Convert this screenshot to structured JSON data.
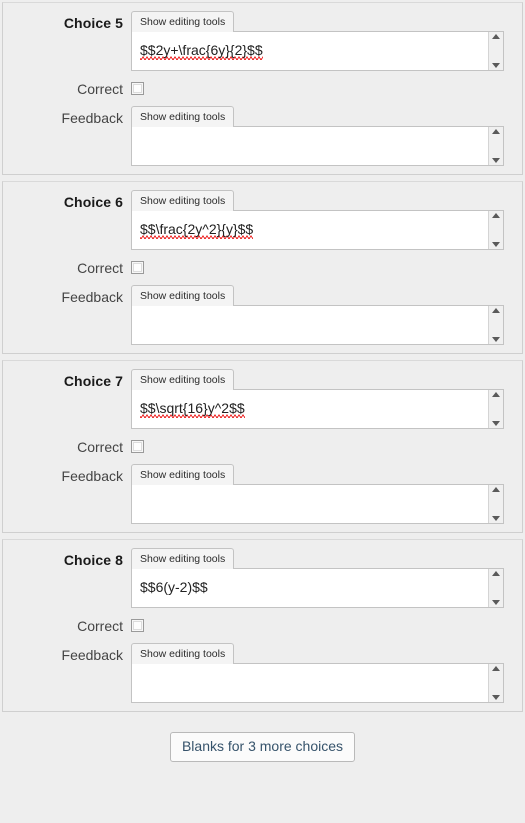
{
  "colors": {
    "page_background": "#eeeeee",
    "panel_border": "#cfcfcf",
    "field_border": "#c3c3c3",
    "text": "#333333",
    "button_text": "#36536b",
    "spellcheck_underline": "#ee3333"
  },
  "labels": {
    "correct": "Correct",
    "feedback": "Feedback",
    "editor_toggle": "Show editing tools"
  },
  "choices": [
    {
      "title": "Choice 5",
      "editor_toggle": "Show editing tools",
      "text_value": "$$2y+\\frac{6y}{2}$$",
      "text_placeholder": "",
      "correct_label": "Correct",
      "correct_checked": false,
      "feedback_label": "Feedback",
      "feedback_editor_toggle": "Show editing tools",
      "feedback_value": "",
      "feedback_placeholder": ""
    },
    {
      "title": "Choice 6",
      "editor_toggle": "Show editing tools",
      "text_value": "$$\\frac{2y^2}{y}$$",
      "text_placeholder": "",
      "correct_label": "Correct",
      "correct_checked": false,
      "feedback_label": "Feedback",
      "feedback_editor_toggle": "Show editing tools",
      "feedback_value": "",
      "feedback_placeholder": ""
    },
    {
      "title": "Choice 7",
      "editor_toggle": "Show editing tools",
      "text_value": "$$\\sqrt{16}y^2$$",
      "text_placeholder": "",
      "correct_label": "Correct",
      "correct_checked": false,
      "feedback_label": "Feedback",
      "feedback_editor_toggle": "Show editing tools",
      "feedback_value": "",
      "feedback_placeholder": ""
    },
    {
      "title": "Choice 8",
      "editor_toggle": "Show editing tools",
      "text_value": "$$6(y-2)$$",
      "text_placeholder": "",
      "correct_label": "Correct",
      "correct_checked": false,
      "feedback_label": "Feedback",
      "feedback_editor_toggle": "Show editing tools",
      "feedback_value": "",
      "feedback_placeholder": ""
    }
  ],
  "footer": {
    "more_choices_button": "Blanks for 3 more choices"
  },
  "icons": {
    "scroll_up": "scroll-up-arrow-icon",
    "scroll_down": "scroll-down-arrow-icon"
  }
}
